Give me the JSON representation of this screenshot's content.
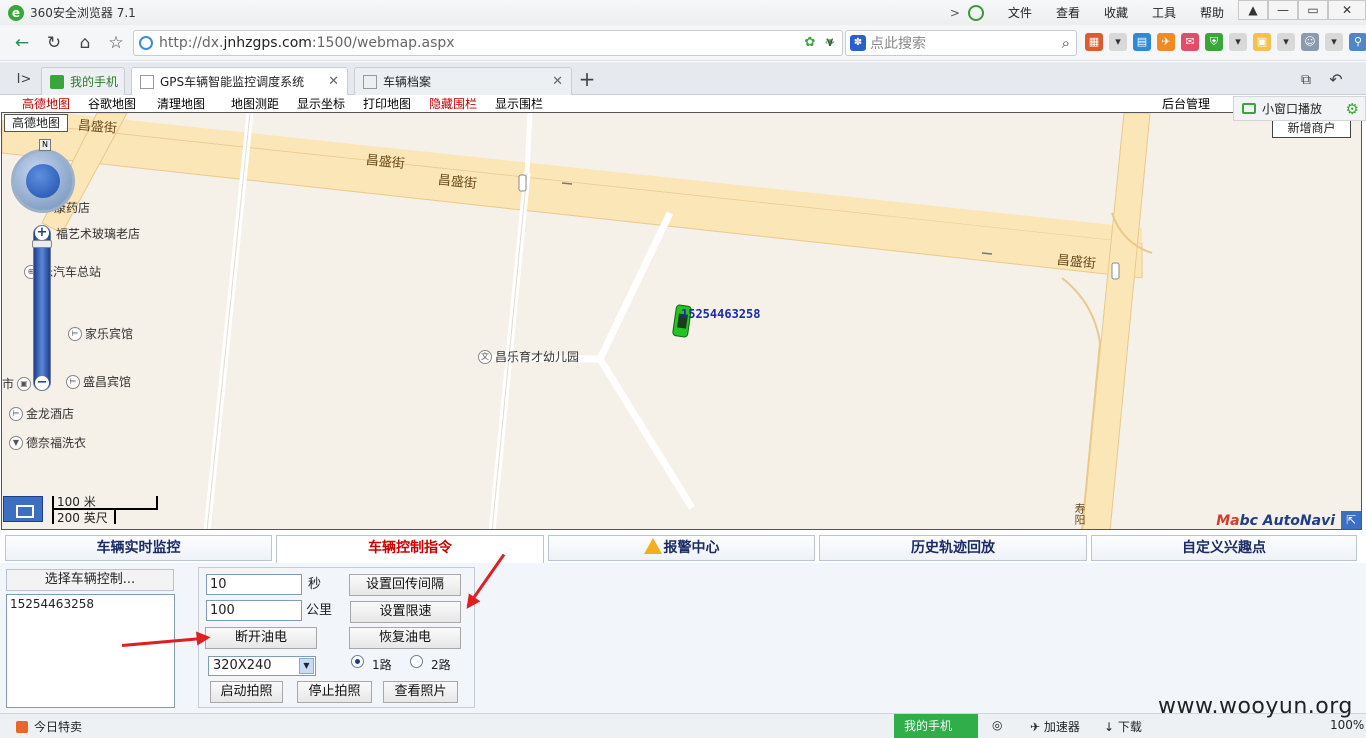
{
  "browser": {
    "title": "360安全浏览器 7.1",
    "menus": [
      "文件",
      "查看",
      "收藏",
      "工具",
      "帮助"
    ],
    "url_host_prefix": "http://dx.",
    "url_host": "jnhzgps.com",
    "url_rest": ":1500/webmap.aspx",
    "search_placeholder": "点此搜索"
  },
  "tabs": [
    {
      "label": "我的手机"
    },
    {
      "label": "GPS车辆智能监控调度系统"
    },
    {
      "label": "车辆档案"
    }
  ],
  "map_toolbar": {
    "items": [
      {
        "label": "高德地图",
        "red": true
      },
      {
        "label": "谷歌地图",
        "red": false
      },
      {
        "label": "清理地图",
        "red": false
      },
      {
        "label": "地图测距",
        "red": false
      },
      {
        "label": "显示坐标",
        "red": false
      },
      {
        "label": "打印地图",
        "red": false
      },
      {
        "label": "隐藏围栏",
        "red": true
      },
      {
        "label": "显示围栏",
        "red": false
      }
    ],
    "admin": "后台管理",
    "mini_play": "小窗口播放"
  },
  "map": {
    "provider_button": "高德地图",
    "add_merchant": "新增商户",
    "compass_n": "N",
    "roads": [
      "昌盛街",
      "昌盛街",
      "昌盛街",
      "昌盛街"
    ],
    "road_vertical": "寿阳",
    "pois": [
      {
        "name": "康药店"
      },
      {
        "name": "福艺术玻璃老店"
      },
      {
        "name": "乐汽车总站"
      },
      {
        "name": "家乐宾馆"
      },
      {
        "name": "盛昌宾馆"
      },
      {
        "name": "金龙酒店"
      },
      {
        "name": "德奈福洗衣"
      },
      {
        "name": "昌乐育才幼儿园"
      },
      {
        "name": "市"
      }
    ],
    "scale_metric": "100 米",
    "scale_imperial": "200 英尺",
    "vehicle_label": "15254463258",
    "brand_left": "Ma",
    "brand_mid": "bc",
    "brand_right": " AutoNavi"
  },
  "control_tabs": [
    "车辆实时监控",
    "车辆控制指令",
    "报警中心",
    "历史轨迹回放",
    "自定义兴趣点"
  ],
  "control": {
    "select_header": "选择车辆控制...",
    "vehicles": [
      "15254463258"
    ],
    "interval_value": "10",
    "interval_unit": "秒",
    "set_interval": "设置回传间隔",
    "speed_value": "100",
    "speed_unit": "公里",
    "set_speed": "设置限速",
    "cut_power": "断开油电",
    "restore_power": "恢复油电",
    "resolution": "320X240",
    "channel1": "1路",
    "channel2": "2路",
    "start_photo": "启动拍照",
    "stop_photo": "停止拍照",
    "view_photo": "查看照片"
  },
  "status": {
    "today": "今日特卖",
    "phone": "我的手机",
    "accel": "加速器",
    "download": "下载",
    "zoom": "100%"
  },
  "watermark": "www.wooyun.org"
}
